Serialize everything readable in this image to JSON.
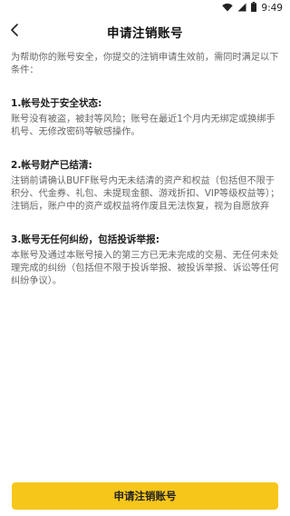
{
  "status_bar": {
    "time": "9:49",
    "icons": [
      "wifi-icon",
      "cellular-icon",
      "battery-icon"
    ]
  },
  "header": {
    "back_icon": "chevron-left-icon",
    "title": "申请注销账号"
  },
  "content": {
    "intro": "为帮助你的账号安全，你提交的注销申请生效前，需同时满足以下条件：",
    "sections": [
      {
        "title": "1.帐号处于安全状态:",
        "body": "账号没有被盗，被封等风险；账号在最近1个月内无绑定或换绑手机号、无修改密码等敏感操作。"
      },
      {
        "title": "2.帐号财产已结清:",
        "body": "注销前请确认BUFF账号内无未结清的资产和权益（包括但不限于积分、代金券、礼包、未提现金额、游戏折扣、VIP等级权益等）；注销后，账户中的资产或权益将作废且无法恢复，视为自愿放弃"
      },
      {
        "title": "3.账号无任何纠纷，包括投诉举报:",
        "body": "本账号及通过本账号接入的第三方已无未完成的交易、无任何未处理完成的纠纷（包括但不限于投诉举报、被投诉举报、诉讼等任何纠纷争议）。"
      }
    ]
  },
  "footer": {
    "button_label": "申请注销账号"
  },
  "colors": {
    "accent": "#f7c61a",
    "title_text": "#111111",
    "body_text": "#666666"
  }
}
